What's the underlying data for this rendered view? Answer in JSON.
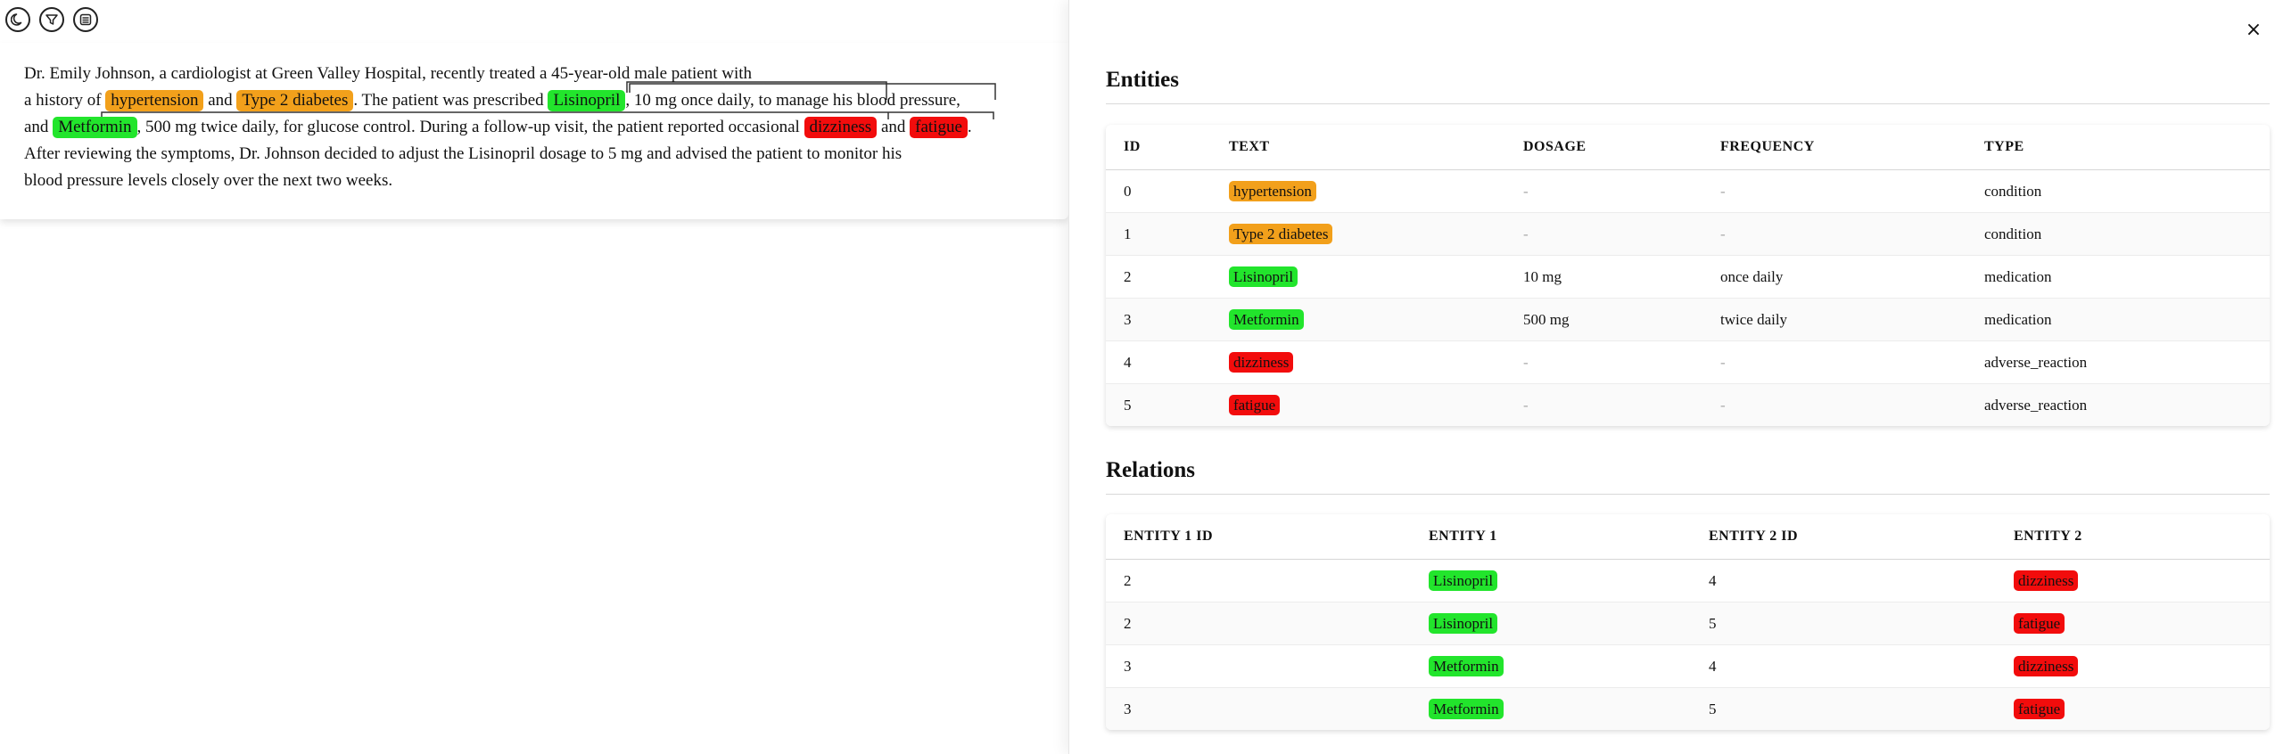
{
  "toolbar": {
    "buttons": [
      {
        "icon": "moon-icon"
      },
      {
        "icon": "filter-icon"
      },
      {
        "icon": "list-icon"
      }
    ]
  },
  "document": {
    "line1": "Dr. Emily Johnson, a cardiologist at Green Valley Hospital, recently treated a 45-year-old male patient with",
    "line2_pre": "a history of ",
    "ent_hypertension": "hypertension",
    "line2_and": " and ",
    "ent_t2d": "Type 2 diabetes",
    "line2_mid": ". The patient was prescribed ",
    "ent_lisinopril": "Lisinopril",
    "line2_post": ", 10 mg once daily, to manage his blood pressure,",
    "line3_pre": "and ",
    "ent_metformin": "Metformin",
    "line3_mid": ", 500 mg twice daily, for glucose control. During a follow-up visit, the patient reported occasional ",
    "ent_dizziness": "dizziness",
    "line3_and": " and ",
    "ent_fatigue": "fatigue",
    "line3_end": ".",
    "line4": "After reviewing the symptoms, Dr. Johnson decided to adjust the Lisinopril dosage to 5 mg and advised the patient to monitor his",
    "line5": "blood pressure levels closely over the next two weeks."
  },
  "panel": {
    "close_label": "×",
    "entities_title": "Entities",
    "relations_title": "Relations",
    "entities_headers": [
      "ID",
      "TEXT",
      "DOSAGE",
      "FREQUENCY",
      "TYPE"
    ],
    "entities": [
      {
        "id": "0",
        "text": "hypertension",
        "dosage": "-",
        "frequency": "-",
        "type": "condition"
      },
      {
        "id": "1",
        "text": "Type 2 diabetes",
        "dosage": "-",
        "frequency": "-",
        "type": "condition"
      },
      {
        "id": "2",
        "text": "Lisinopril",
        "dosage": "10 mg",
        "frequency": "once daily",
        "type": "medication"
      },
      {
        "id": "3",
        "text": "Metformin",
        "dosage": "500 mg",
        "frequency": "twice daily",
        "type": "medication"
      },
      {
        "id": "4",
        "text": "dizziness",
        "dosage": "-",
        "frequency": "-",
        "type": "adverse_reaction"
      },
      {
        "id": "5",
        "text": "fatigue",
        "dosage": "-",
        "frequency": "-",
        "type": "adverse_reaction"
      }
    ],
    "relations_headers": [
      "ENTITY 1 ID",
      "ENTITY 1",
      "ENTITY 2 ID",
      "ENTITY 2"
    ],
    "relations": [
      {
        "e1_id": "2",
        "e1": "Lisinopril",
        "e2_id": "4",
        "e2": "dizziness"
      },
      {
        "e1_id": "2",
        "e1": "Lisinopril",
        "e2_id": "5",
        "e2": "fatigue"
      },
      {
        "e1_id": "3",
        "e1": "Metformin",
        "e2_id": "4",
        "e2": "dizziness"
      },
      {
        "e1_id": "3",
        "e1": "Metformin",
        "e2_id": "5",
        "e2": "fatigue"
      }
    ]
  },
  "colors": {
    "condition": "#f2a01b",
    "medication": "#22e52c",
    "adverse_reaction": "#f20c0c"
  }
}
